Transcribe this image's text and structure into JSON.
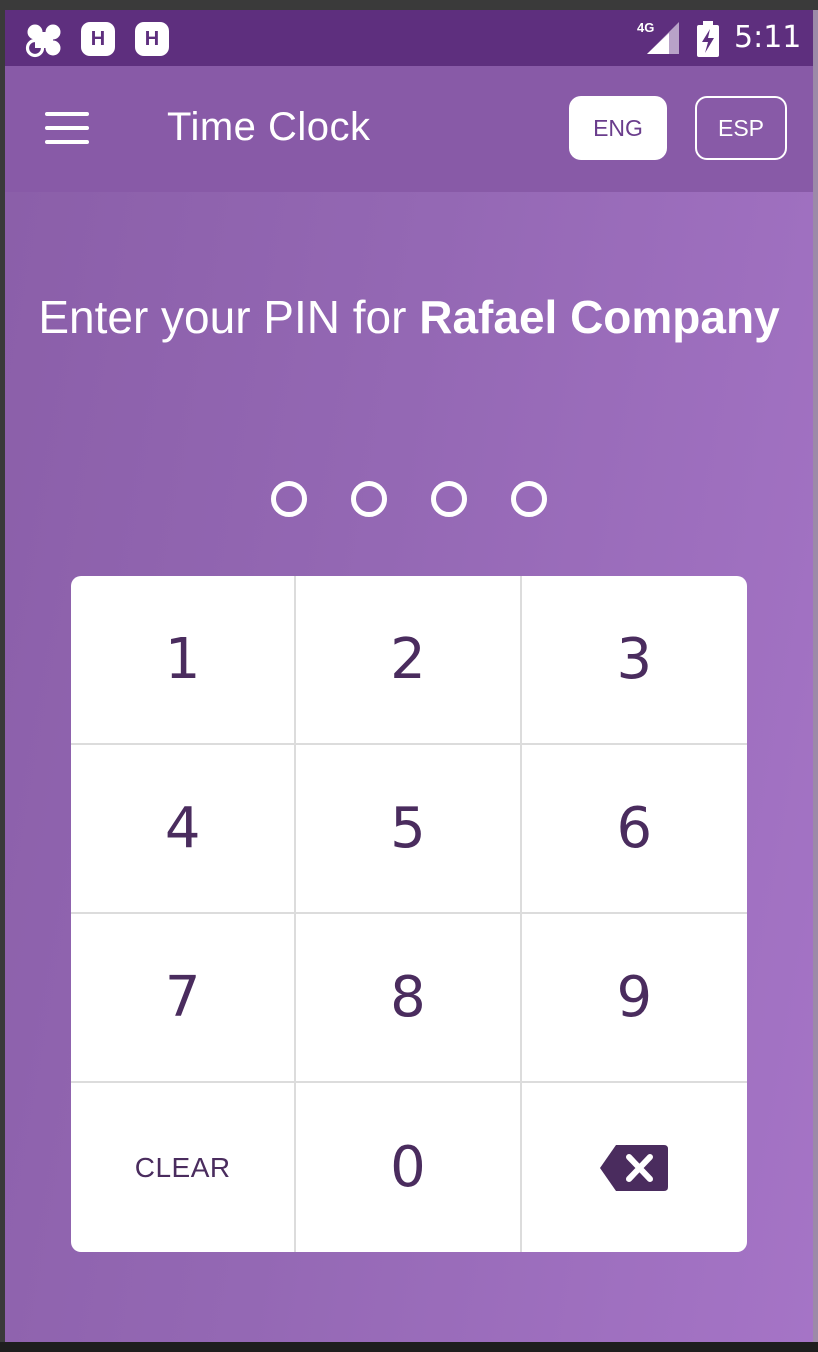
{
  "status_bar": {
    "network": "4G",
    "time": "5:11",
    "icons": [
      "app-logo-icon",
      "h-notification-icon",
      "h-notification-icon",
      "signal-icon",
      "battery-charging-icon"
    ],
    "h_label": "H"
  },
  "header": {
    "title": "Time Clock",
    "menu_icon": "hamburger-menu-icon",
    "languages": [
      {
        "label": "ENG",
        "selected": true
      },
      {
        "label": "ESP",
        "selected": false
      }
    ]
  },
  "prompt": {
    "prefix": "Enter your PIN for ",
    "company": "Rafael Company"
  },
  "pin": {
    "length": 4,
    "entered": 0
  },
  "keypad": {
    "keys": [
      "1",
      "2",
      "3",
      "4",
      "5",
      "6",
      "7",
      "8",
      "9",
      "CLEAR",
      "0"
    ],
    "backspace_icon": "backspace-icon"
  },
  "colors": {
    "status_bar": "#5e2f7e",
    "header": "#885aa7",
    "background_start": "#8a5ea8",
    "background_end": "#a574c6",
    "key_text": "#4a2c5e",
    "accent": "#ffffff"
  }
}
